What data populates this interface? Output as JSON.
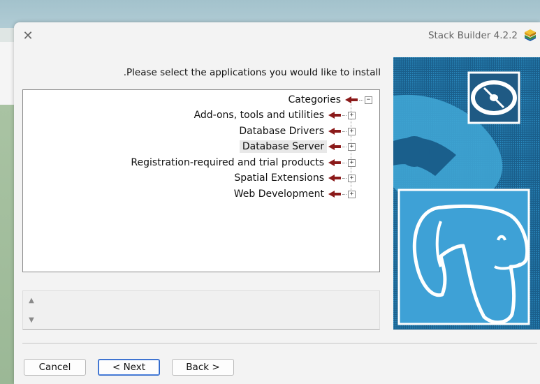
{
  "window": {
    "title": "Stack Builder 4.2.2",
    "close_glyph": "✕"
  },
  "instruction": "Please select the applications you would like to install.",
  "tree": {
    "root": {
      "label": "Categories",
      "expander": "−"
    },
    "items": [
      {
        "label": "Add-ons, tools and utilities",
        "expander": "+"
      },
      {
        "label": "Database Drivers",
        "expander": "+"
      },
      {
        "label": "Database Server",
        "expander": "+",
        "selected": true
      },
      {
        "label": "Registration-required and trial products",
        "expander": "+"
      },
      {
        "label": "Spatial Extensions",
        "expander": "+"
      },
      {
        "label": "Web Development",
        "expander": "+"
      }
    ]
  },
  "description": {
    "scroll_up": "▲",
    "scroll_down": "▼"
  },
  "buttons": {
    "cancel": "Cancel",
    "next": "< Next",
    "back": "Back >"
  },
  "icons": {
    "app": "stack-builder-logo-icon",
    "tree_arrow": "red-arrow-icon",
    "disc": "disc-icon",
    "elephant": "postgresql-elephant-icon"
  },
  "colors": {
    "arrow": "#8b1a1a",
    "panel": "#1c6fa0",
    "panel_light": "#3fa4d3"
  }
}
